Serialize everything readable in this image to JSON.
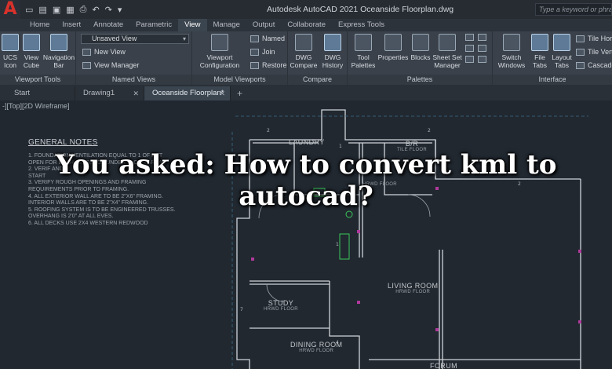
{
  "titlebar": {
    "logo": "A",
    "title": "Autodesk AutoCAD 2021   Oceanside Floorplan.dwg",
    "search_placeholder": "Type a keyword or phrase"
  },
  "tabs": [
    "Home",
    "Insert",
    "Annotate",
    "Parametric",
    "View",
    "Manage",
    "Output",
    "Collaborate",
    "Express Tools"
  ],
  "active_tab": "View",
  "ribbon": {
    "viewport_tools": {
      "label": "Viewport Tools",
      "ucs": "UCS Icon",
      "viewcube": "View Cube",
      "navbar": "Navigation Bar"
    },
    "named_views": {
      "label": "Named Views",
      "dropdown": "Unsaved View",
      "new_view": "New View",
      "view_manager": "View Manager"
    },
    "model_viewports": {
      "label": "Model Viewports",
      "viewport_config": "Viewport Configuration",
      "named": "Named",
      "join": "Join",
      "restore": "Restore"
    },
    "compare": {
      "label": "Compare",
      "dwg_compare": "DWG Compare",
      "dwg_history": "DWG History"
    },
    "palettes": {
      "label": "Palettes",
      "tool_palettes": "Tool Palettes",
      "properties": "Properties",
      "blocks": "Blocks",
      "sheet_set": "Sheet Set Manager"
    },
    "interface": {
      "label": "Interface",
      "switch_windows": "Switch Windows",
      "file_tabs": "File Tabs",
      "layout_tabs": "Layout Tabs",
      "tile_horiz": "Tile Hori",
      "tile_vert": "Tile Verti",
      "cascade": "Cascade"
    }
  },
  "file_tabs": [
    "Start",
    "Drawing1",
    "Oceanside Floorplan*"
  ],
  "view_label": "-][Top][2D Wireframe]",
  "notes": {
    "title": "GENERAL NOTES",
    "lines": [
      "1.   FOUNDATION VENTILATION EQUAL TO 1      OF NET",
      "     OPEN          FOR EACH 150 S.F. OF UNDER FLOOR AREA",
      "2.   VERIF          AND",
      "     START",
      "3.   VERIFY ROUGH OPENINGS AND FRAMING",
      "     REQUIREMENTS PRIOR TO FRAMING.",
      "4.   ALL EXTERIOR WALL ARE TO BE 2\"X6\" FRAMING.",
      "     INTERIOR WALLS ARE TO BE 2\"X4\" FRAMING.",
      "5.   ROOFING SYSTEM IS TO BE ENGINEERED TRUSSES.",
      "     OVERHANG IS 2'0\" AT ALL EVES.",
      "6.   ALL DECKS USE 2X4 WESTERN REDWOOD"
    ]
  },
  "rooms": {
    "laundry": "LAUNDRY",
    "br": "B/R",
    "br_floor": "TILE FLOOR",
    "hrwd_small": "HRWD FLOOR",
    "living": "LIVING ROOM",
    "living_floor": "HRWD FLOOR",
    "study": "STUDY",
    "study_floor": "HRWD FLOOR",
    "dining": "DINING ROOM",
    "dining_floor": "HRWD FLOOR",
    "forum": "FORUM"
  },
  "headline": "You asked: How to convert kml to autocad?"
}
